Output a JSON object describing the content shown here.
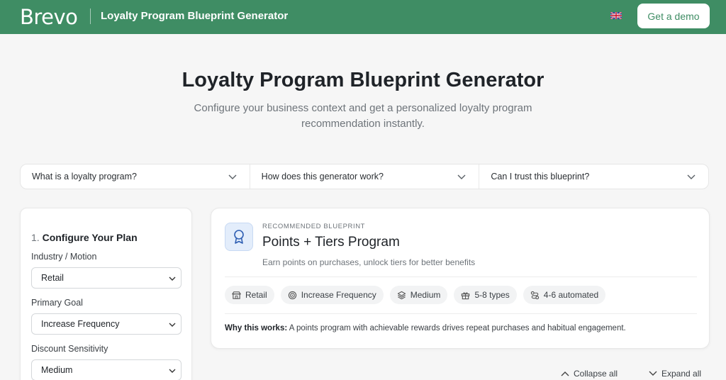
{
  "header": {
    "logo": "Brevo",
    "app_title": "Loyalty Program Blueprint Generator",
    "flag_icon": "uk-flag-icon",
    "demo_label": "Get a demo",
    "bg_color": "#3f8d64"
  },
  "hero": {
    "title": "Loyalty Program Blueprint Generator",
    "subtitle": "Configure your business context and get a personalized loyalty program recommendation instantly."
  },
  "faq": [
    {
      "label": "What is a loyalty program?",
      "icon": "chevron-down-icon"
    },
    {
      "label": "How does this generator work?",
      "icon": "chevron-down-icon"
    },
    {
      "label": "Can I trust this blueprint?",
      "icon": "chevron-down-icon"
    }
  ],
  "config": {
    "step_number": "1.",
    "heading": "Configure Your Plan",
    "fields": [
      {
        "label": "Industry / Motion",
        "value": "Retail"
      },
      {
        "label": "Primary Goal",
        "value": "Increase Frequency"
      },
      {
        "label": "Discount Sensitivity",
        "value": "Medium"
      }
    ]
  },
  "recommendation": {
    "icon": "award-ribbon-icon",
    "eyebrow": "RECOMMENDED BLUEPRINT",
    "title": "Points + Tiers Program",
    "description": "Earn points on purchases, unlock tiers for better benefits",
    "chips": [
      {
        "icon": "store-icon",
        "label": "Retail"
      },
      {
        "icon": "target-icon",
        "label": "Increase Frequency"
      },
      {
        "icon": "layers-icon",
        "label": "Medium"
      },
      {
        "icon": "gift-icon",
        "label": "5-8 types"
      },
      {
        "icon": "workflow-icon",
        "label": "4-6 automated"
      }
    ],
    "why_label": "Why this works:",
    "why_text": "A points program with achievable rewards drives repeat purchases and habitual engagement."
  },
  "controls": {
    "collapse_label": "Collapse all",
    "expand_label": "Expand all"
  }
}
